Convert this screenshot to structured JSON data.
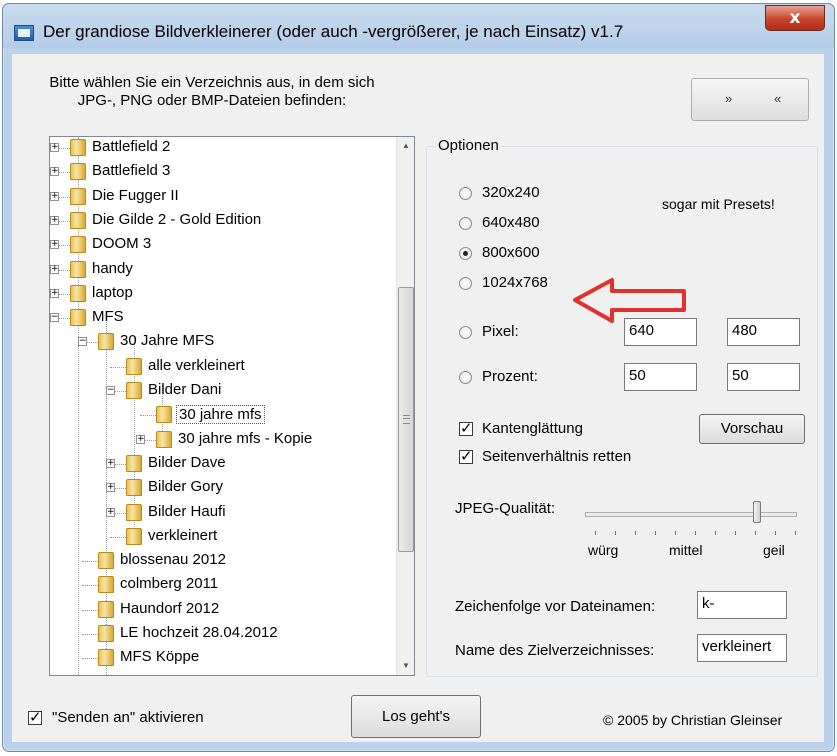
{
  "window": {
    "title": "Der grandiose Bildverkleinerer (oder auch -vergrößerer, je nach Einsatz) v1.7",
    "close": "x"
  },
  "instruction": {
    "line1": "Bitte wählen Sie ein Verzeichnis aus, in dem sich",
    "line2": "JPG-, PNG oder BMP-Dateien befinden:"
  },
  "nav": {
    "forward": "»",
    "back": "«"
  },
  "tree": {
    "items": [
      {
        "label": "Battlefield 2"
      },
      {
        "label": "Battlefield 3"
      },
      {
        "label": "Die Fugger II"
      },
      {
        "label": "Die Gilde 2 - Gold Edition"
      },
      {
        "label": "DOOM 3"
      },
      {
        "label": "handy"
      },
      {
        "label": "laptop"
      },
      {
        "label": "MFS"
      },
      {
        "label": "30 Jahre MFS"
      },
      {
        "label": "alle verkleinert"
      },
      {
        "label": "Bilder Dani"
      },
      {
        "label": "30 jahre mfs"
      },
      {
        "label": "30 jahre mfs - Kopie"
      },
      {
        "label": "Bilder Dave"
      },
      {
        "label": "Bilder Gory"
      },
      {
        "label": "Bilder Haufi"
      },
      {
        "label": "verkleinert"
      },
      {
        "label": "blossenau 2012"
      },
      {
        "label": "colmberg 2011"
      },
      {
        "label": "Haundorf 2012"
      },
      {
        "label": "LE hochzeit 28.04.2012"
      },
      {
        "label": "MFS Köppe"
      }
    ]
  },
  "options": {
    "title": "Optionen",
    "presets_note": "sogar mit Presets!",
    "presets": [
      "320x240",
      "640x480",
      "800x600",
      "1024x768"
    ],
    "selected_preset": "800x600",
    "pixel": {
      "label": "Pixel:",
      "width": "640",
      "height": "480"
    },
    "percent": {
      "label": "Prozent:",
      "width": "50",
      "height": "50"
    },
    "antialias": {
      "label": "Kantenglättung",
      "checked": true
    },
    "aspect": {
      "label": "Seitenverhältnis retten",
      "checked": true
    },
    "preview_button": "Vorschau",
    "jpeg": {
      "label": "JPEG-Qualität:",
      "low": "würg",
      "mid": "mittel",
      "high": "geil",
      "value_fraction": 0.82
    },
    "prefix": {
      "label": "Zeichenfolge vor Dateinamen:",
      "value": "k-"
    },
    "target_dir": {
      "label": "Name des Zielverzeichnisses:",
      "value": "verkleinert"
    }
  },
  "footer": {
    "send_to": {
      "label": "\"Senden an\" aktivieren",
      "checked": true
    },
    "go_button": "Los geht's",
    "copyright": "© 2005 by Christian Gleinser"
  },
  "colors": {
    "annotation_arrow": "#e2302c"
  }
}
